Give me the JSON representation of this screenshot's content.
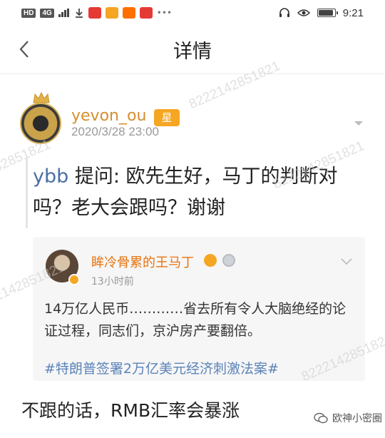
{
  "status_bar": {
    "network_label": "HD",
    "signal_label": "4G",
    "time": "9:21"
  },
  "nav": {
    "title": "详情",
    "back_icon": "chevron-left-icon"
  },
  "post": {
    "username": "yevon_ou",
    "badge": "星",
    "time": "2020/3/28 23:00",
    "question_user": "ybb",
    "question_text": "提问: 欧先生好，马丁的判断对吗？老大会跟吗？谢谢",
    "answer": "不跟的话，RMB汇率会暴涨"
  },
  "quoted": {
    "name": "眸冷骨累的王马丁",
    "time": "13小时前",
    "text": "14万亿人民币…………省去所有令人大脑绝经的论证过程，同志们，京沪房产要翻倍。",
    "tag": "#特朗普签署2万亿美元经济刺激法案#"
  },
  "watermark": {
    "brand": "欧神小密圈",
    "number": "8222142851821"
  },
  "colors": {
    "username": "#d58f2e",
    "badge_bg": "#f5a623",
    "quoted_name": "#e8720c",
    "tag": "#5b83b8",
    "question_user": "#4a6fa5"
  }
}
